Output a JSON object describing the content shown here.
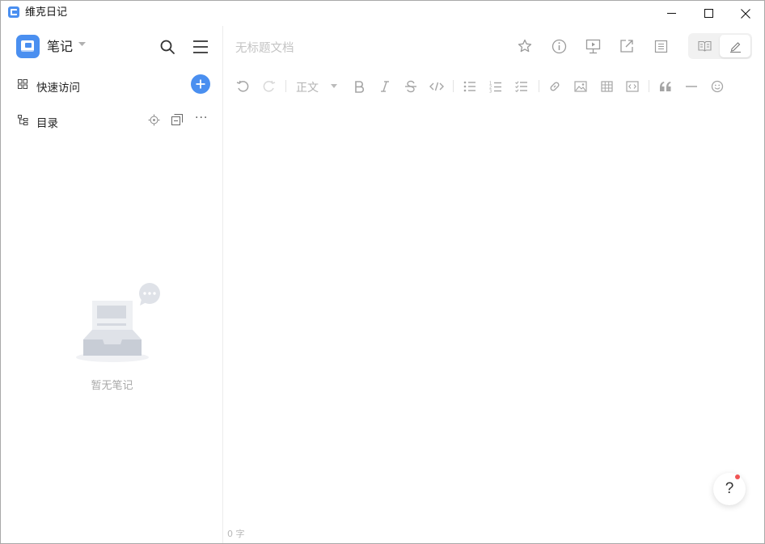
{
  "window": {
    "title": "维克日记",
    "controls": [
      "minimize-icon",
      "maximize-icon",
      "close-icon"
    ]
  },
  "sidebar": {
    "brand_title": "笔记",
    "brand_icon": "notebook-icon",
    "search_icon": "search-icon",
    "menu_icon": "hamburger-menu-icon",
    "quick_access": {
      "label": "快速访问",
      "icon": "grid-icon",
      "add_icon": "plus-icon"
    },
    "toc": {
      "label": "目录",
      "icon": "tree-icon",
      "actions": [
        "locate-icon",
        "collapse-icon",
        "more-icon"
      ]
    },
    "empty_text": "暂无笔记"
  },
  "editor": {
    "title_placeholder": "无标题文档",
    "header_icons": [
      "star-icon",
      "info-icon",
      "presentation-icon",
      "share-icon",
      "outline-icon"
    ],
    "mode_toggle": [
      "read-mode-icon",
      "edit-mode-icon"
    ],
    "toolbar": {
      "paragraph_style": "正文",
      "items": [
        "undo-icon",
        "redo-icon",
        "bold-icon",
        "italic-icon",
        "strikethrough-icon",
        "inline-code-icon",
        "bullet-list-icon",
        "numbered-list-icon",
        "task-list-icon",
        "link-icon",
        "image-icon",
        "table-icon",
        "code-block-icon",
        "quote-icon",
        "divider-icon",
        "emoji-icon"
      ]
    },
    "word_count": "0 字",
    "help_label": "?"
  },
  "colors": {
    "accent": "#4a8ff0",
    "notification_dot": "#f05454",
    "muted_text": "#c4c4c4"
  }
}
